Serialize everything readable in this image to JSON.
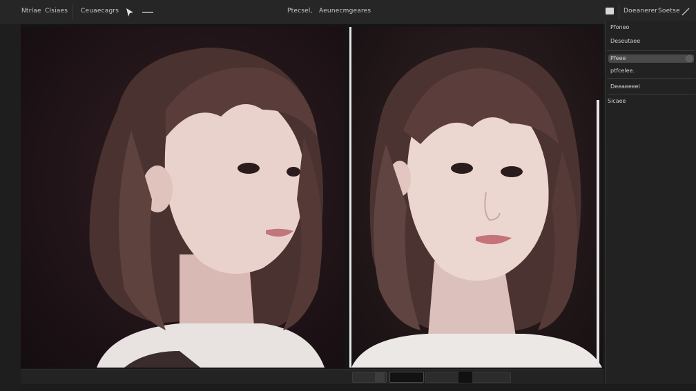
{
  "topbar": {
    "menu_1": "Ntrlae",
    "menu_2": "Clsiaes",
    "menu_3": "Ceuaecagrs",
    "center_1": "Ptecsel,",
    "center_2": "Aeunecmgeares",
    "right_1": "Doeanerer",
    "right_2": "Soetse"
  },
  "right_panel": {
    "item_1": "Pfoneo",
    "item_2": "Deseutaee",
    "item_3": "Pfeee",
    "item_4": "ptfcelee.",
    "item_5": "Deeaeeeel",
    "item_6": "Sicaee"
  },
  "colors": {
    "background": "#1c1c1c",
    "panel": "#222222",
    "topbar": "#262626",
    "highlight": "#e8e8e8"
  },
  "icons": {
    "tool_select": "cursor-icon",
    "tool_line": "minus-icon",
    "tool_draw": "pen-icon",
    "toggle": "square-icon"
  }
}
